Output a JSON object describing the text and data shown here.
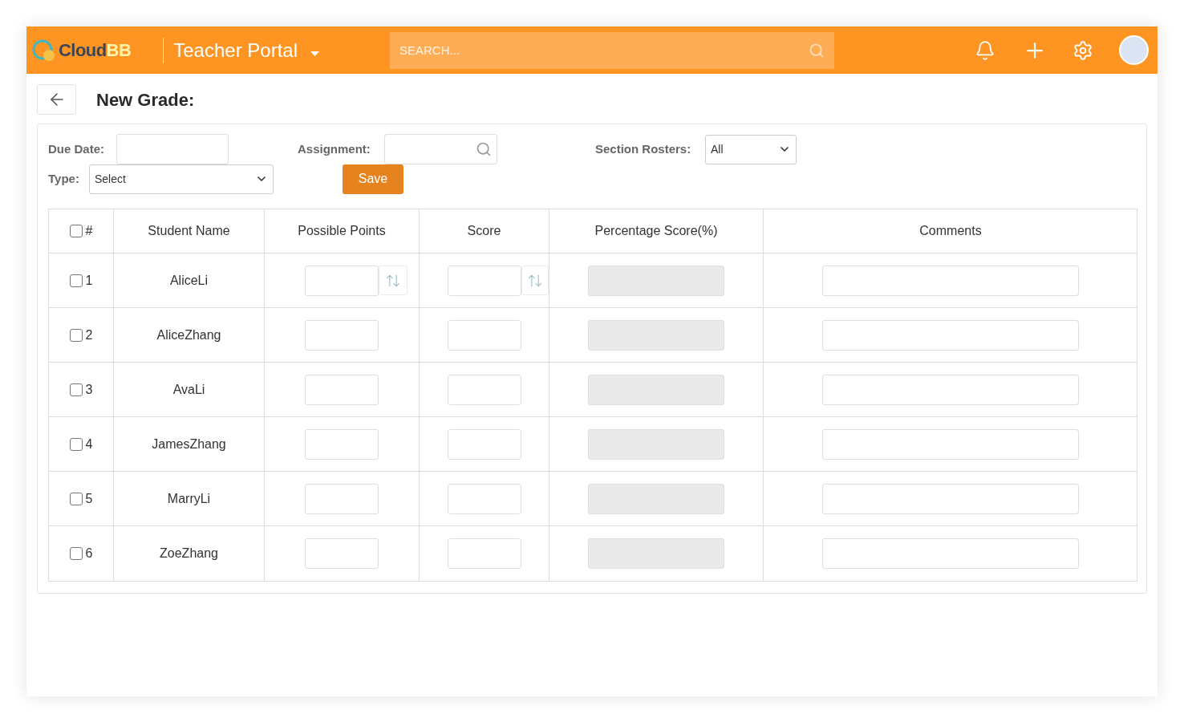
{
  "header": {
    "logo": {
      "part_1": "Cloud",
      "part_2": "BB"
    },
    "portal_title": "Teacher Portal",
    "search": {
      "placeholder": "SEARCH..."
    }
  },
  "page": {
    "title": "New Grade:"
  },
  "form": {
    "due_date": {
      "label": "Due Date:"
    },
    "assignment": {
      "label": "Assignment:"
    },
    "section_rosters": {
      "label": "Section Rosters:",
      "value": "All"
    },
    "type": {
      "label": "Type:",
      "value": "Select"
    },
    "save_button": "Save"
  },
  "table": {
    "select_all": {
      "checked": false
    },
    "columns": [
      "#",
      "Student Name",
      "Possible Points",
      "Score",
      "Percentage Score(%)",
      "Comments"
    ],
    "rows": [
      {
        "number": "1",
        "name": "AliceLi",
        "checked": false,
        "sort_buttons": true
      },
      {
        "number": "2",
        "name": "AliceZhang",
        "checked": false,
        "sort_buttons": false
      },
      {
        "number": "3",
        "name": "AvaLi",
        "checked": false,
        "sort_buttons": false
      },
      {
        "number": "4",
        "name": "JamesZhang",
        "checked": false,
        "sort_buttons": false
      },
      {
        "number": "5",
        "name": "MarryLi",
        "checked": false,
        "sort_buttons": false
      },
      {
        "number": "6",
        "name": "ZoeZhang",
        "checked": false,
        "sort_buttons": false
      }
    ]
  }
}
